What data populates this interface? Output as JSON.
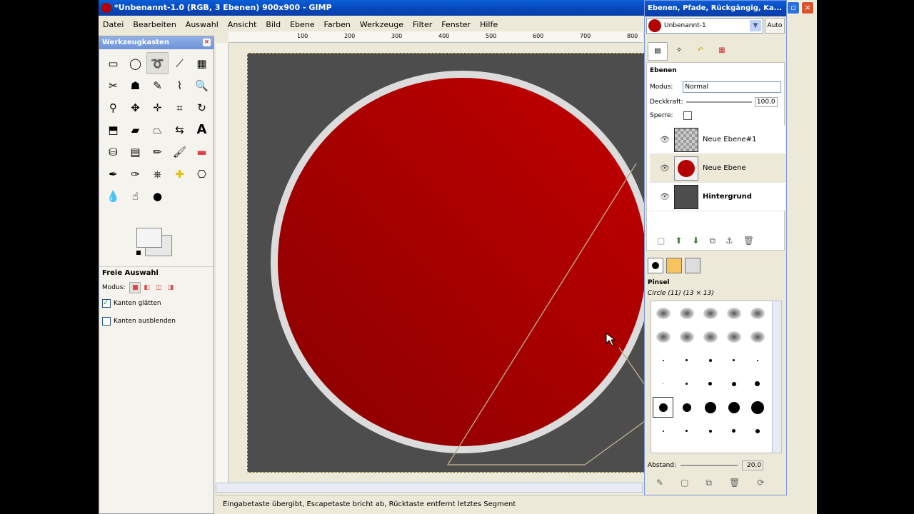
{
  "window": {
    "title": "*Unbenannt-1.0 (RGB, 3 Ebenen) 900x900 - GIMP"
  },
  "menu": [
    "Datei",
    "Bearbeiten",
    "Auswahl",
    "Ansicht",
    "Bild",
    "Ebene",
    "Farben",
    "Werkzeuge",
    "Filter",
    "Fenster",
    "Hilfe"
  ],
  "ruler": {
    "ticks": [
      "100",
      "200",
      "300",
      "400",
      "500",
      "600",
      "700",
      "800"
    ]
  },
  "toolbox": {
    "title": "Werkzeugkasten",
    "options_title": "Freie Auswahl",
    "mode_label": "Modus:",
    "option_antialias": "Kanten glätten",
    "option_feather": "Kanten ausblenden"
  },
  "dock": {
    "title": "Ebenen, Pfade, Rückgängig, Ka...",
    "image_select": "Unbenannt-1",
    "auto_label": "Auto",
    "layers_title": "Ebenen",
    "mode_label": "Modus:",
    "mode_value": "Normal",
    "opacity_label": "Deckkraft:",
    "opacity_value": "100,0",
    "lock_label": "Sperre:",
    "layers": [
      {
        "name": "Neue Ebene#1"
      },
      {
        "name": "Neue Ebene"
      },
      {
        "name": "Hintergrund"
      }
    ],
    "brushes_title": "Pinsel",
    "brush_current": "Circle (11) (13 × 13)",
    "spacing_label": "Abstand:",
    "spacing_value": "20,0"
  },
  "status": {
    "text": "Eingabetaste übergibt, Escapetaste bricht ab, Rücktaste entfernt letztes Segment"
  },
  "colors": {
    "accent": "#0a5fd8",
    "circle": "#b30000",
    "canvas": "#4d4d4d"
  }
}
